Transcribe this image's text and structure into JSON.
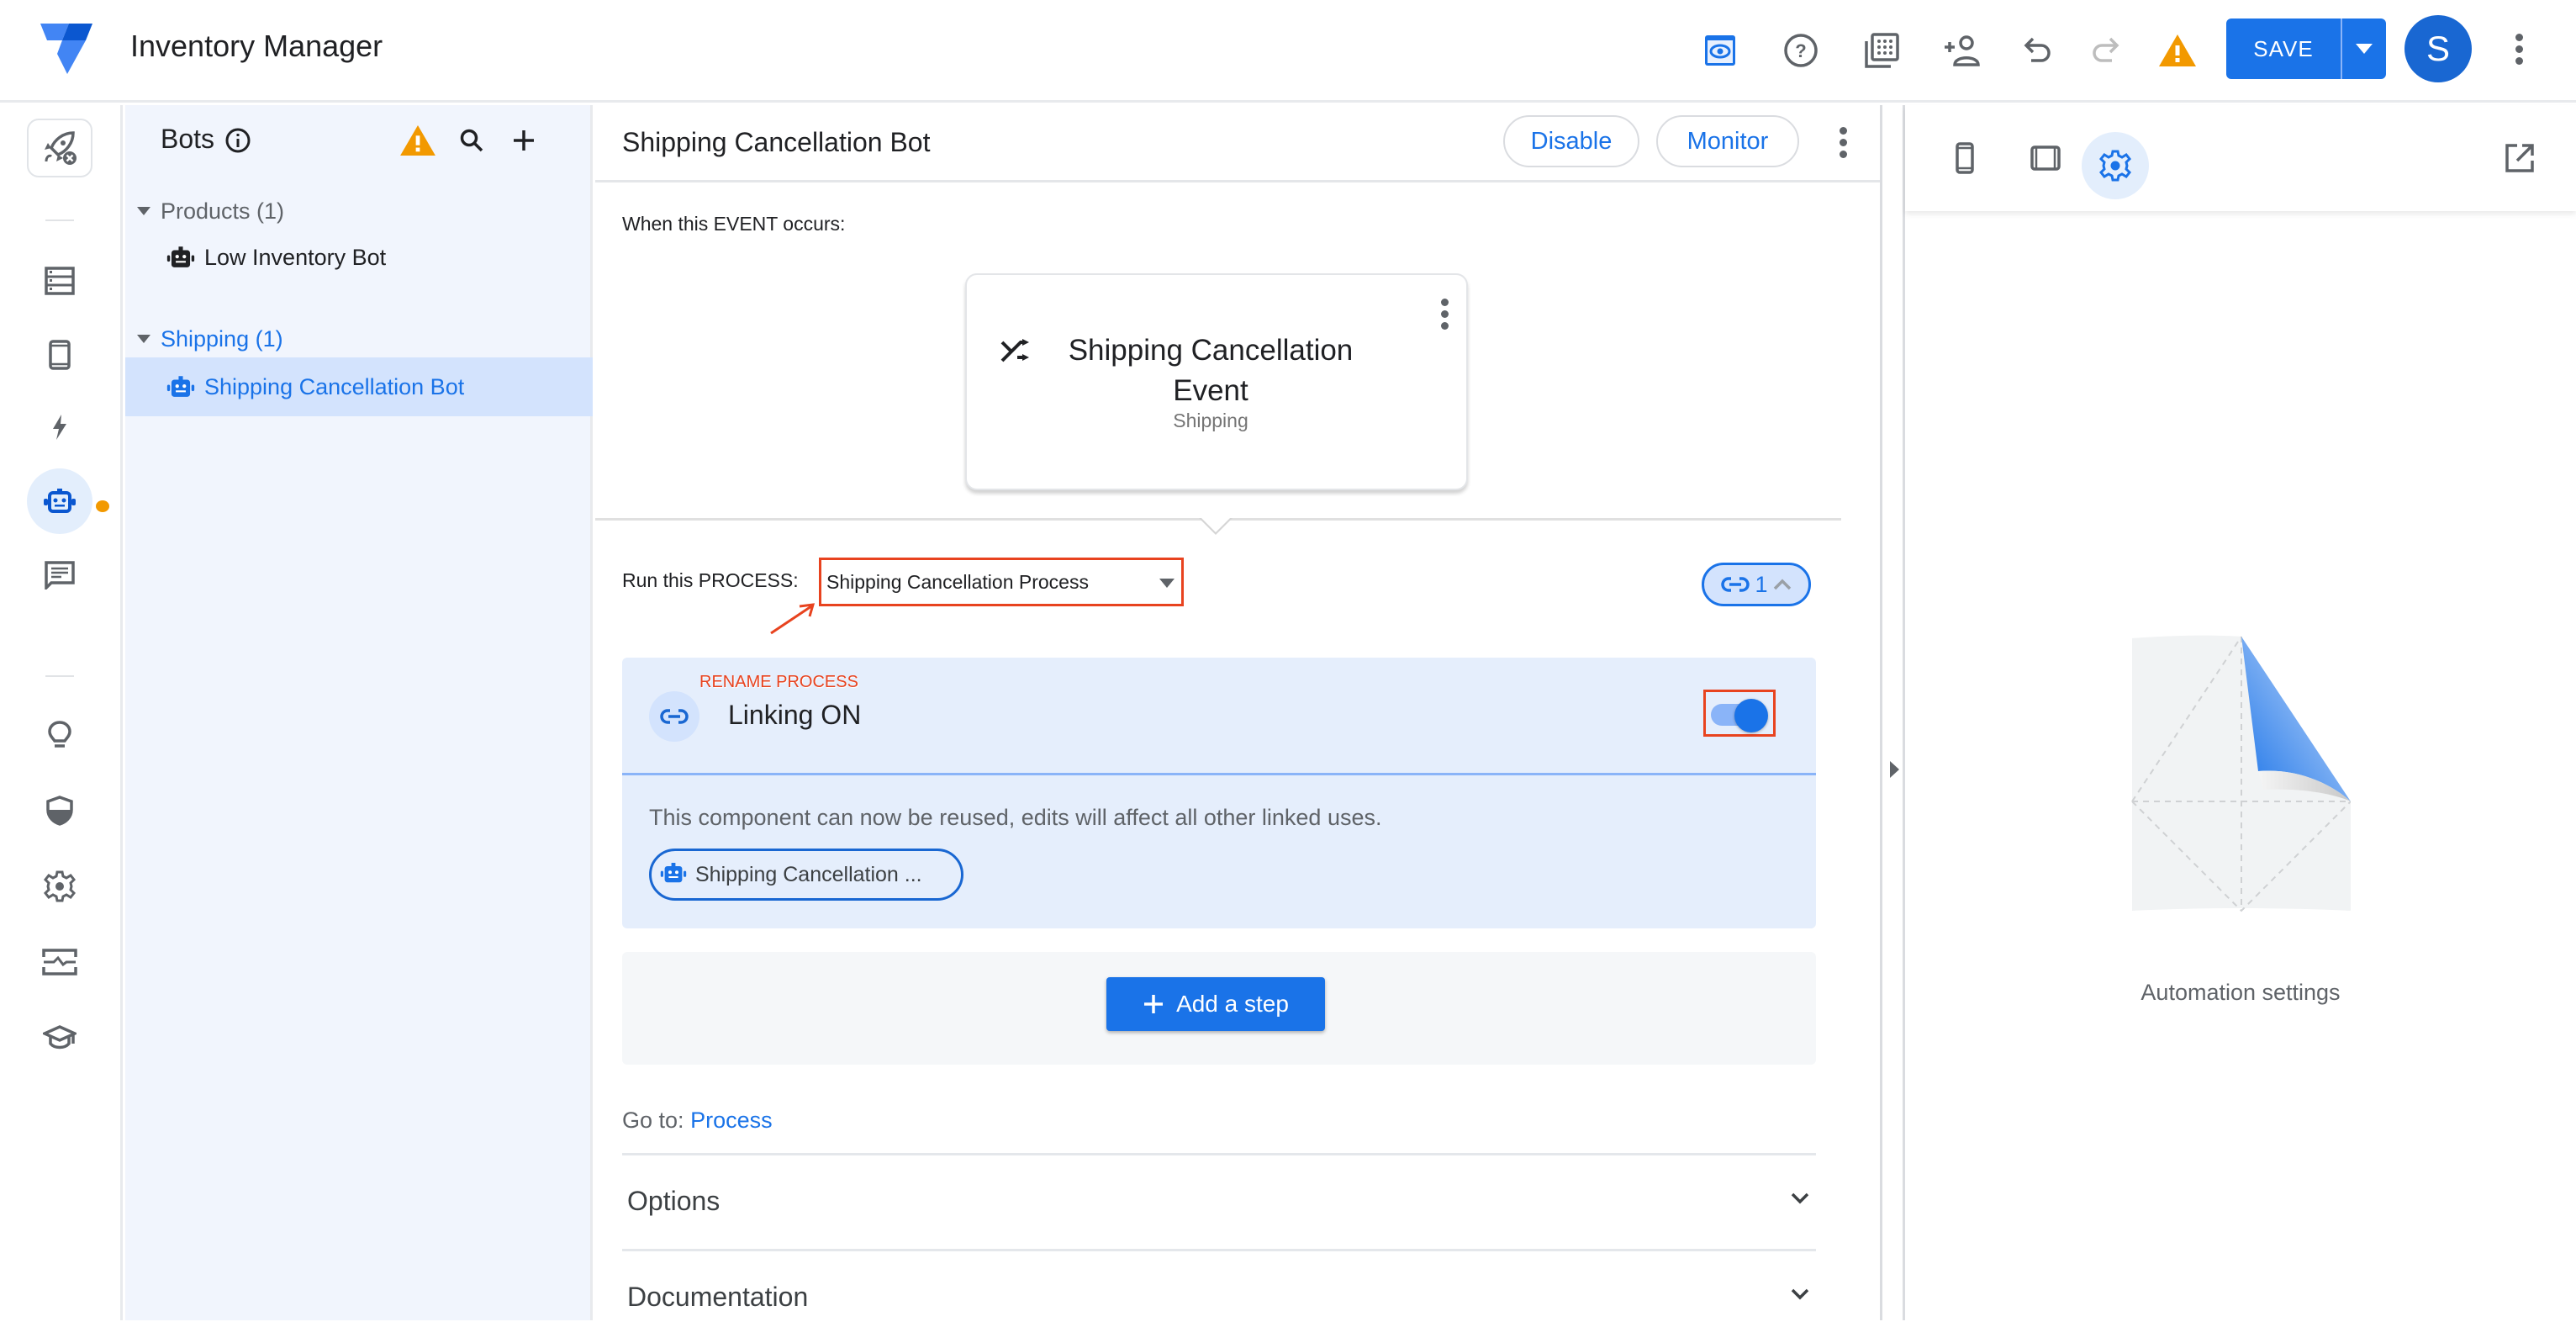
{
  "app": {
    "title": "Inventory Manager",
    "colors": {
      "primary": "#1a73e8",
      "warning": "#f29900",
      "annotation": "#e8431f"
    }
  },
  "topbar": {
    "icons": [
      {
        "name": "preview-icon",
        "active": true
      },
      {
        "name": "help-icon"
      },
      {
        "name": "gallery-icon"
      },
      {
        "name": "share-user-icon"
      },
      {
        "name": "undo-icon"
      },
      {
        "name": "redo-icon",
        "disabled": true
      },
      {
        "name": "warning-icon"
      }
    ],
    "save_label": "SAVE",
    "avatar_initial": "S"
  },
  "rail": {
    "items": [
      {
        "name": "rocket-icon"
      },
      {
        "name": "data-icon"
      },
      {
        "name": "app-icon"
      },
      {
        "name": "actions-icon"
      },
      {
        "name": "bot-icon",
        "active": true,
        "badge": true
      },
      {
        "name": "messages-icon"
      },
      {
        "name": "intelligence-icon"
      },
      {
        "name": "security-icon"
      },
      {
        "name": "settings-icon"
      },
      {
        "name": "monitor-icon"
      },
      {
        "name": "learn-icon"
      }
    ]
  },
  "bots": {
    "title": "Bots",
    "groups": [
      {
        "label": "Products (1)",
        "items": [
          {
            "label": "Low Inventory Bot"
          }
        ]
      },
      {
        "label": "Shipping (1)",
        "selected": true,
        "items": [
          {
            "label": "Shipping Cancellation Bot",
            "selected": true
          }
        ]
      }
    ]
  },
  "editor": {
    "title": "Shipping Cancellation Bot",
    "disable_label": "Disable",
    "monitor_label": "Monitor",
    "event_label": "When this EVENT occurs:",
    "event": {
      "name": "Shipping Cancellation Event",
      "table": "Shipping"
    },
    "process_label": "Run this PROCESS:",
    "process_value": "Shipping Cancellation Process",
    "link_count": "1",
    "rename_annotation": "RENAME PROCESS",
    "linking": {
      "title": "Linking ON",
      "enabled": true,
      "description": "This component can now be reused, edits will affect all other linked uses.",
      "chip_label": "Shipping Cancellation ..."
    },
    "add_step_label": "Add a step",
    "goto_prefix": "Go to:",
    "goto_link": "Process",
    "accordions": [
      {
        "label": "Options"
      },
      {
        "label": "Documentation"
      }
    ]
  },
  "right_panel": {
    "tabs": [
      {
        "name": "mobile-preview-icon"
      },
      {
        "name": "tablet-preview-icon"
      },
      {
        "name": "settings-icon",
        "active": true
      }
    ],
    "empty_label": "Automation settings"
  }
}
